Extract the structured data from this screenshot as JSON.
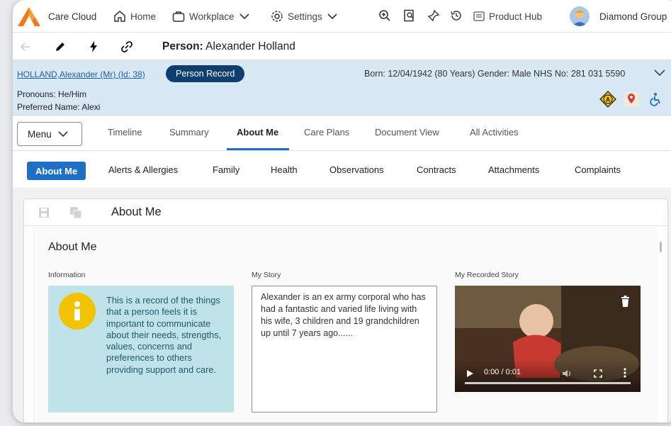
{
  "topbar": {
    "app_name": "Care Cloud",
    "home_label": "Home",
    "workplace_label": "Workplace",
    "settings_label": "Settings",
    "product_hub_label": "Product Hub",
    "org_name": "Diamond Group"
  },
  "person": {
    "prefix": "Person:",
    "name": "Alexander Holland"
  },
  "banner": {
    "patient_link": "HOLLAND,Alexander (Mr) (Id: 38)",
    "record_button": "Person Record",
    "born_info": "Born: 12/04/1942 (80 Years)  Gender: Male  NHS No: 281 031 5590",
    "pronouns": "Pronouns: He/Him",
    "preferred_name": "Preferred Name: Alexi"
  },
  "tabs": {
    "menu_label": "Menu",
    "items": [
      "Timeline",
      "Summary",
      "About Me",
      "Care Plans",
      "Document View",
      "All Activities"
    ],
    "active": "About Me"
  },
  "subtabs": {
    "items": [
      "About Me",
      "Alerts & Allergies",
      "Family",
      "Health",
      "Observations",
      "Contracts",
      "Attachments",
      "Complaints"
    ],
    "active": "About Me"
  },
  "card": {
    "title": "About Me",
    "section_title": "About Me",
    "labels": {
      "information": "Information",
      "my_story": "My Story",
      "my_recorded_story": "My Recorded Story"
    },
    "info_text": "This is a record of the things that a person feels it is important to communicate about their needs, strengths, values, concerns and preferences to others providing support and care.",
    "story_text": "Alexander is an ex army corporal who has had a fantastic and varied life living with his wife, 3 children and 19 grandchildren up until 7 years ago......",
    "video_time": "0:00 / 0:01"
  },
  "colors": {
    "accent": "#1d70c5",
    "banner_bg": "#d8e8f5",
    "record_pill": "#0f3f6e",
    "info_bg": "#bfe3e8",
    "info_icon": "#f2c400"
  }
}
